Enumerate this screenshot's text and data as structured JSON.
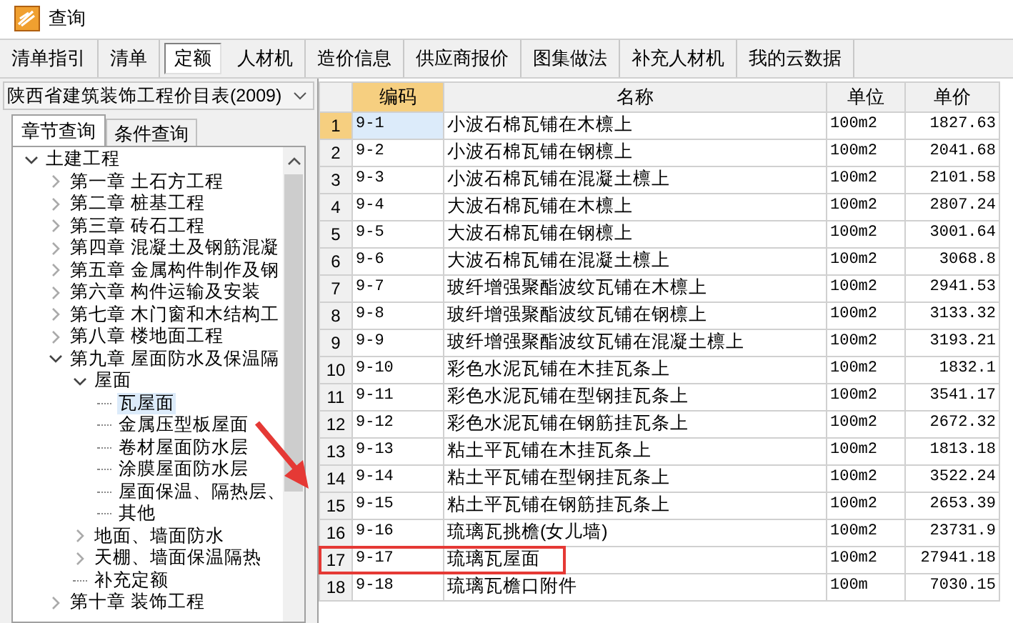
{
  "window": {
    "title": "查询"
  },
  "toolbar_tabs": [
    {
      "label": "清单指引",
      "selected": false
    },
    {
      "label": "清单",
      "selected": false
    },
    {
      "label": "定额",
      "selected": true
    },
    {
      "label": "人材机",
      "selected": false
    },
    {
      "label": "造价信息",
      "selected": false
    },
    {
      "label": "供应商报价",
      "selected": false
    },
    {
      "label": "图集做法",
      "selected": false
    },
    {
      "label": "补充人材机",
      "selected": false
    },
    {
      "label": "我的云数据",
      "selected": false
    }
  ],
  "library_select": {
    "value": "陕西省建筑装饰工程价目表(2009)"
  },
  "query_tabs": [
    {
      "label": "章节查询",
      "selected": true
    },
    {
      "label": "条件查询",
      "selected": false
    }
  ],
  "tree": [
    {
      "label": "土建工程",
      "expanded": true,
      "selected": false,
      "children": [
        {
          "label": "第一章 土石方工程",
          "expanded": false,
          "selected": false
        },
        {
          "label": "第二章 桩基工程",
          "expanded": false,
          "selected": false
        },
        {
          "label": "第三章 砖石工程",
          "expanded": false,
          "selected": false
        },
        {
          "label": "第四章 混凝土及钢筋混凝",
          "expanded": false,
          "selected": false
        },
        {
          "label": "第五章 金属构件制作及钢",
          "expanded": false,
          "selected": false
        },
        {
          "label": "第六章 构件运输及安装",
          "expanded": false,
          "selected": false
        },
        {
          "label": "第七章 木门窗和木结构工",
          "expanded": false,
          "selected": false
        },
        {
          "label": "第八章 楼地面工程",
          "expanded": false,
          "selected": false
        },
        {
          "label": "第九章 屋面防水及保温隔",
          "expanded": true,
          "selected": false,
          "children": [
            {
              "label": "屋面",
              "expanded": true,
              "selected": false,
              "children": [
                {
                  "label": "瓦屋面",
                  "selected": true
                },
                {
                  "label": "金属压型板屋面",
                  "selected": false
                },
                {
                  "label": "卷材屋面防水层",
                  "selected": false
                },
                {
                  "label": "涂膜屋面防水层",
                  "selected": false
                },
                {
                  "label": "屋面保温、隔热层、",
                  "selected": false
                },
                {
                  "label": "其他",
                  "selected": false
                }
              ]
            },
            {
              "label": "地面、墙面防水",
              "expanded": false,
              "selected": false
            },
            {
              "label": "天棚、墙面保温隔热",
              "expanded": false,
              "selected": false
            },
            {
              "label": "补充定额",
              "selected": false
            }
          ]
        },
        {
          "label": "第十章 装饰工程",
          "expanded": false,
          "selected": false
        }
      ]
    }
  ],
  "table": {
    "columns": [
      {
        "label": "编码",
        "selected": true
      },
      {
        "label": "名称",
        "selected": false
      },
      {
        "label": "单位",
        "selected": false
      },
      {
        "label": "单价",
        "selected": false
      }
    ],
    "rows": [
      {
        "index": "1",
        "code": "9-1",
        "name": "小波石棉瓦铺在木檩上",
        "unit": "100m2",
        "price": "1827.63",
        "selected": true,
        "highlighted": false
      },
      {
        "index": "2",
        "code": "9-2",
        "name": "小波石棉瓦铺在钢檩上",
        "unit": "100m2",
        "price": "2041.68",
        "selected": false,
        "highlighted": false
      },
      {
        "index": "3",
        "code": "9-3",
        "name": "小波石棉瓦铺在混凝土檩上",
        "unit": "100m2",
        "price": "2101.58",
        "selected": false,
        "highlighted": false
      },
      {
        "index": "4",
        "code": "9-4",
        "name": "大波石棉瓦铺在木檩上",
        "unit": "100m2",
        "price": "2807.24",
        "selected": false,
        "highlighted": false
      },
      {
        "index": "5",
        "code": "9-5",
        "name": "大波石棉瓦铺在钢檩上",
        "unit": "100m2",
        "price": "3001.64",
        "selected": false,
        "highlighted": false
      },
      {
        "index": "6",
        "code": "9-6",
        "name": "大波石棉瓦铺在混凝土檩上",
        "unit": "100m2",
        "price": "3068.8",
        "selected": false,
        "highlighted": false
      },
      {
        "index": "7",
        "code": "9-7",
        "name": "玻纤增强聚酯波纹瓦铺在木檩上",
        "unit": "100m2",
        "price": "2941.53",
        "selected": false,
        "highlighted": false
      },
      {
        "index": "8",
        "code": "9-8",
        "name": "玻纤增强聚酯波纹瓦铺在钢檩上",
        "unit": "100m2",
        "price": "3133.32",
        "selected": false,
        "highlighted": false
      },
      {
        "index": "9",
        "code": "9-9",
        "name": "玻纤增强聚酯波纹瓦铺在混凝土檩上",
        "unit": "100m2",
        "price": "3193.21",
        "selected": false,
        "highlighted": false
      },
      {
        "index": "10",
        "code": "9-10",
        "name": "彩色水泥瓦铺在木挂瓦条上",
        "unit": "100m2",
        "price": "1832.1",
        "selected": false,
        "highlighted": false
      },
      {
        "index": "11",
        "code": "9-11",
        "name": "彩色水泥瓦铺在型钢挂瓦条上",
        "unit": "100m2",
        "price": "3541.17",
        "selected": false,
        "highlighted": false
      },
      {
        "index": "12",
        "code": "9-12",
        "name": "彩色水泥瓦铺在钢筋挂瓦条上",
        "unit": "100m2",
        "price": "2672.32",
        "selected": false,
        "highlighted": false
      },
      {
        "index": "13",
        "code": "9-13",
        "name": "粘土平瓦铺在木挂瓦条上",
        "unit": "100m2",
        "price": "1813.18",
        "selected": false,
        "highlighted": false
      },
      {
        "index": "14",
        "code": "9-14",
        "name": "粘土平瓦铺在型钢挂瓦条上",
        "unit": "100m2",
        "price": "3522.24",
        "selected": false,
        "highlighted": false
      },
      {
        "index": "15",
        "code": "9-15",
        "name": "粘土平瓦铺在钢筋挂瓦条上",
        "unit": "100m2",
        "price": "2653.39",
        "selected": false,
        "highlighted": false
      },
      {
        "index": "16",
        "code": "9-16",
        "name": "琉璃瓦挑檐(女儿墙)",
        "unit": "100m2",
        "price": "23731.9",
        "selected": false,
        "highlighted": false
      },
      {
        "index": "17",
        "code": "9-17",
        "name": "琉璃瓦屋面",
        "unit": "100m2",
        "price": "27941.18",
        "selected": false,
        "highlighted": true
      },
      {
        "index": "18",
        "code": "9-18",
        "name": "琉璃瓦檐口附件",
        "unit": "100m",
        "price": "7030.15",
        "selected": false,
        "highlighted": false
      }
    ]
  }
}
